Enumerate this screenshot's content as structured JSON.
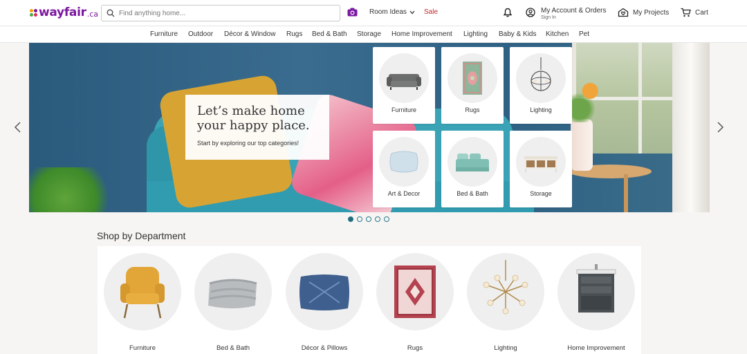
{
  "header": {
    "logo_word": "wayfair",
    "logo_tld": ".ca",
    "search_placeholder": "Find anything home...",
    "room_ideas": "Room Ideas",
    "sale": "Sale",
    "account_label": "My Account & Orders",
    "account_sub": "Sign In",
    "projects_label": "My Projects",
    "cart_label": "Cart"
  },
  "nav": {
    "items": [
      "Furniture",
      "Outdoor",
      "Décor & Window",
      "Rugs",
      "Bed & Bath",
      "Storage",
      "Home Improvement",
      "Lighting",
      "Baby & Kids",
      "Kitchen",
      "Pet"
    ]
  },
  "hero": {
    "title": "Let’s make home your happy place.",
    "subtitle": "Start by exploring our top categories!",
    "tiles": [
      "Furniture",
      "Rugs",
      "Lighting",
      "Art & Decor",
      "Bed & Bath",
      "Storage"
    ],
    "slide_count": 5,
    "active_slide": 1
  },
  "department": {
    "title": "Shop by Department",
    "items": [
      "Furniture",
      "Bed & Bath",
      "Décor & Pillows",
      "Rugs",
      "Lighting",
      "Home Improvement"
    ]
  },
  "colors": {
    "brand": "#7b189f",
    "sale": "#c2262b",
    "dot": "#1f6a7c"
  },
  "icons": {
    "search": "search-icon",
    "camera": "camera-icon",
    "bell": "bell-icon",
    "account": "account-icon",
    "projects": "projects-icon",
    "cart": "cart-icon",
    "prev": "chevron-left-icon",
    "next": "chevron-right-icon"
  }
}
